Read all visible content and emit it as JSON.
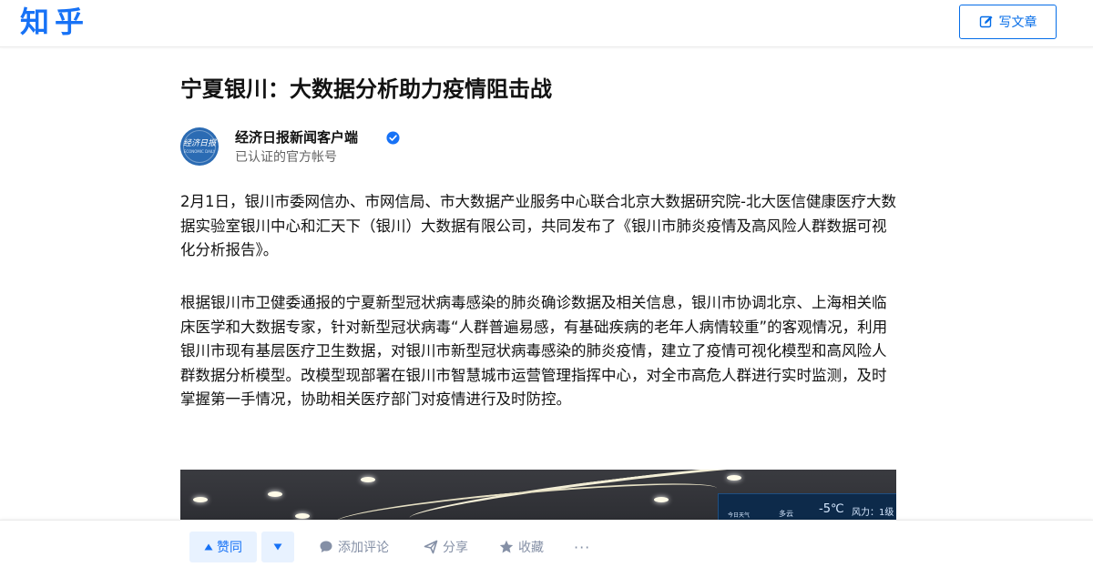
{
  "header": {
    "logo": "知乎",
    "write_button": "写文章"
  },
  "article": {
    "title": "宁夏银川：大数据分析助力疫情阻击战",
    "author": {
      "name": "经济日报新闻客户端",
      "description": "已认证的官方帐号",
      "avatar_text": "经济日报",
      "avatar_subtext": "ECONOMIC DAILY"
    },
    "paragraphs": [
      "2月1日，银川市委网信办、市网信局、市大数据产业服务中心联合北京大数据研究院-北大医信健康医疗大数据实验室银川中心和汇天下（银川）大数据有限公司，共同发布了《银川市肺炎疫情及高风险人群数据可视化分析报告》。",
      "根据银川市卫健委通报的宁夏新型冠状病毒感染的肺炎确诊数据及相关信息，银川市协调北京、上海相关临床医学和大数据专家，针对新型冠状病毒“人群普遍易感，有基础疾病的老年人病情较重”的客观情况，利用银川市现有基层医疗卫生数据，对银川市新型冠状病毒感染的肺炎疫情，建立了疫情可视化模型和高风险人群数据分析模型。改模型现部署在银川市智慧城市运营管理指挥中心，对全市高危人群进行实时监测，及时掌握第一手情况，协助相关医疗部门对疫情进行及时防控。"
    ],
    "photo_screen": {
      "label1": "今日天气",
      "label2": "多云",
      "temp": "-5℃",
      "wind": "风力：1级"
    }
  },
  "actions": {
    "vote_up": "赞同",
    "comment": "添加评论",
    "share": "分享",
    "favorite": "收藏",
    "more": "···"
  },
  "colors": {
    "brand": "#1772f6",
    "muted": "#8590a6",
    "vote_bg": "#e8f2ff"
  }
}
